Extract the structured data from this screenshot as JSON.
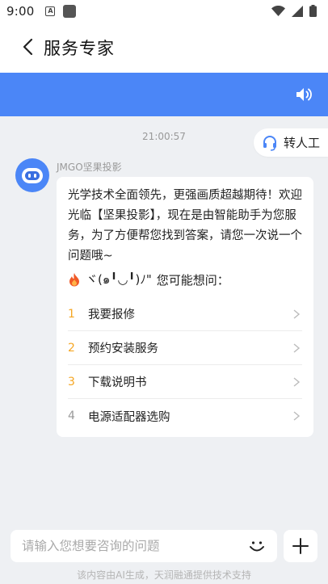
{
  "status_bar": {
    "time": "9:00",
    "a_icon": "A"
  },
  "header": {
    "title": "服务专家"
  },
  "chat": {
    "timestamp": "21:00:57",
    "human_button": "转人工",
    "sender_name": "JMGO坚果投影",
    "greeting": "光学技术全面领先，更强画质超越期待！欢迎光临【坚果投影】，现在是由智能助手为您服务，为了方便帮您找到答案，请您一次说一个问题哦~",
    "prompt_kaomoji": "ヾ(๑╹◡╹)ﾉ\"",
    "prompt_text": "您可能想问：",
    "questions": [
      {
        "num": "1",
        "text": "我要报修",
        "color": "#f5a623"
      },
      {
        "num": "2",
        "text": "预约安装服务",
        "color": "#f5a623"
      },
      {
        "num": "3",
        "text": "下载说明书",
        "color": "#f5a623"
      },
      {
        "num": "4",
        "text": "电源适配器选购",
        "color": "#999999"
      }
    ]
  },
  "input": {
    "placeholder": "请输入您想要咨询的问题"
  },
  "footer": {
    "note": "该内容由AI生成，天润融通提供技术支持"
  },
  "colors": {
    "accent_blue": "#4b86f7",
    "top_question_number": "#f5a623",
    "other_question_number": "#999999"
  }
}
